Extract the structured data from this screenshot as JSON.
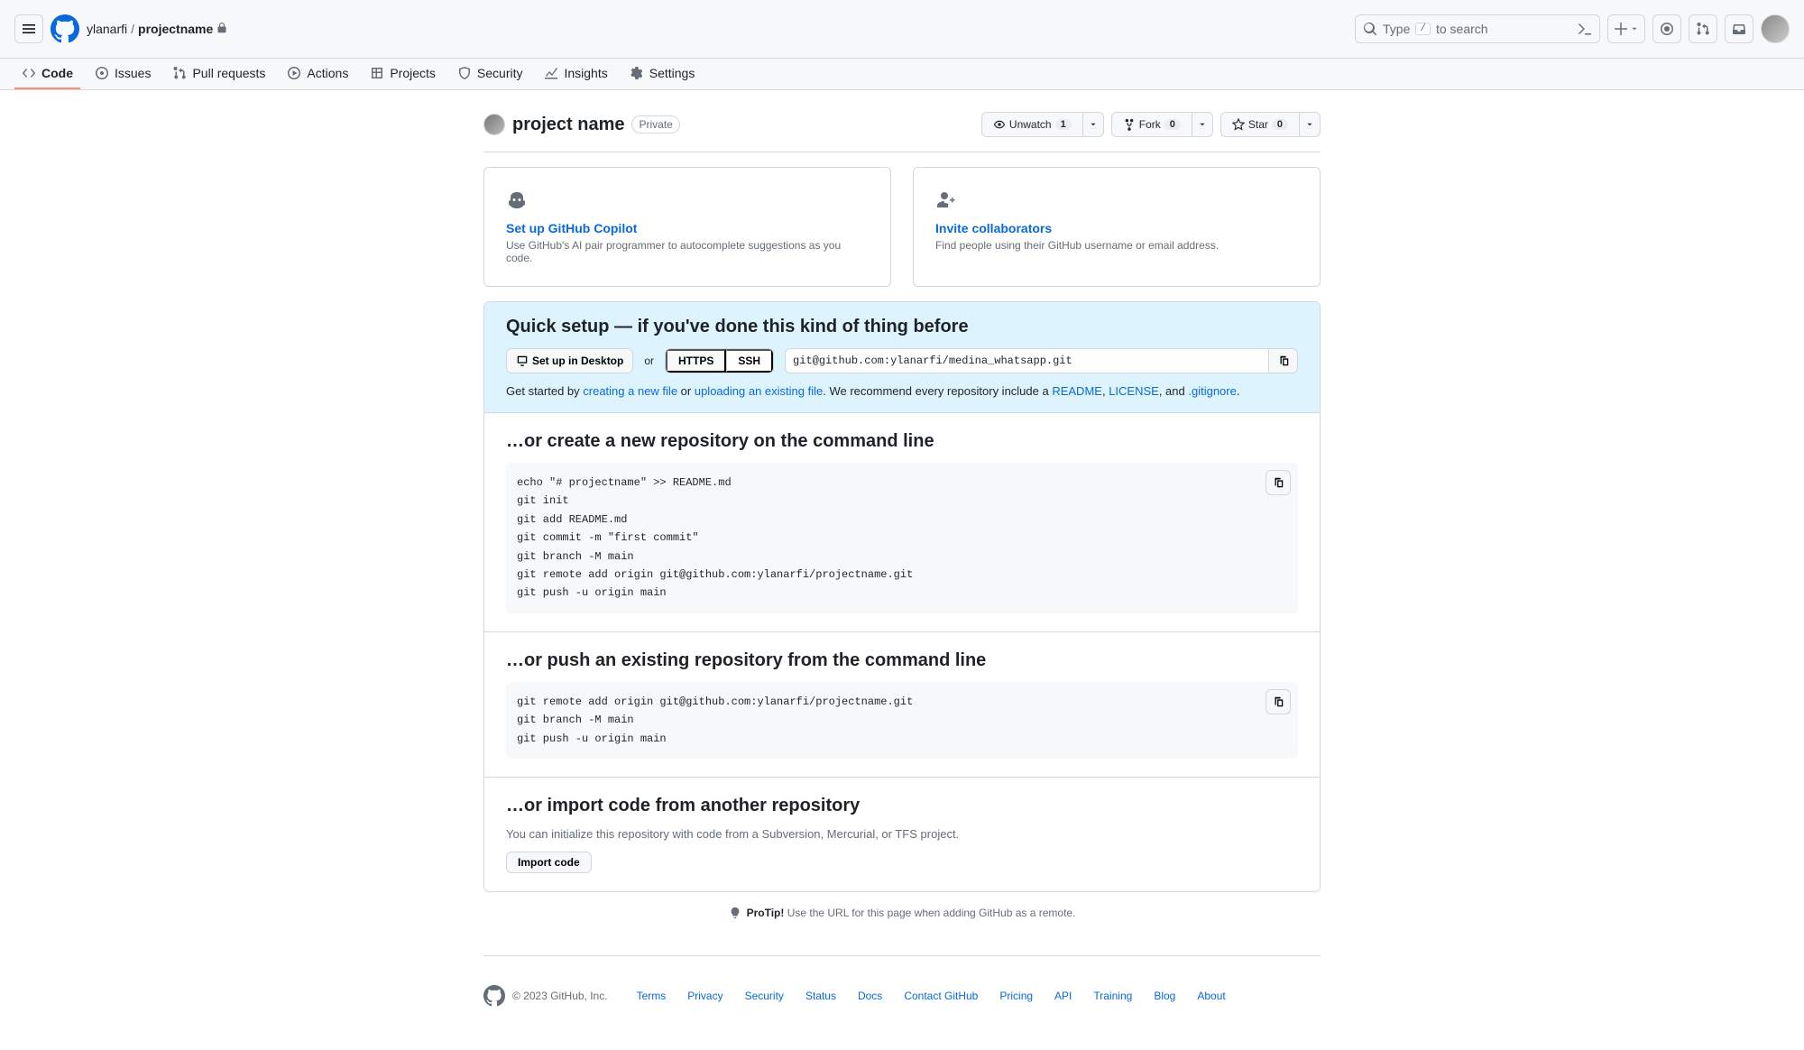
{
  "header": {
    "owner": "ylanarfi",
    "repo": "projectname",
    "search_prefix": "Type",
    "search_key": "/",
    "search_suffix": "to search"
  },
  "nav": {
    "code": "Code",
    "issues": "Issues",
    "pull": "Pull requests",
    "actions": "Actions",
    "projects": "Projects",
    "security": "Security",
    "insights": "Insights",
    "settings": "Settings"
  },
  "title": {
    "name": "project name",
    "visibility": "Private",
    "unwatch": "Unwatch",
    "watch_count": "1",
    "fork": "Fork",
    "fork_count": "0",
    "star": "Star",
    "star_count": "0"
  },
  "cards": {
    "copilot_title": "Set up GitHub Copilot",
    "copilot_desc": "Use GitHub's AI pair programmer to autocomplete suggestions as you code.",
    "invite_title": "Invite collaborators",
    "invite_desc": "Find people using their GitHub username or email address."
  },
  "quick": {
    "heading": "Quick setup — if you've done this kind of thing before",
    "desktop": "Set up in Desktop",
    "or": "or",
    "https": "HTTPS",
    "ssh": "SSH",
    "url": "git@github.com:ylanarfi/medina_whatsapp.git",
    "getstarted_prefix": "Get started by ",
    "create_link": "creating a new file",
    "or2": " or ",
    "upload_link": "uploading an existing file",
    "recommend": ". We recommend every repository include a ",
    "readme": "README",
    "sep1": ", ",
    "license": "LICENSE",
    "sep2": ", and ",
    "gitignore": ".gitignore",
    "period": "."
  },
  "create": {
    "heading": "…or create a new repository on the command line",
    "code": "echo \"# projectname\" >> README.md\ngit init\ngit add README.md\ngit commit -m \"first commit\"\ngit branch -M main\ngit remote add origin git@github.com:ylanarfi/projectname.git\ngit push -u origin main"
  },
  "push": {
    "heading": "…or push an existing repository from the command line",
    "code": "git remote add origin git@github.com:ylanarfi/projectname.git\ngit branch -M main\ngit push -u origin main"
  },
  "import": {
    "heading": "…or import code from another repository",
    "desc": "You can initialize this repository with code from a Subversion, Mercurial, or TFS project.",
    "button": "Import code"
  },
  "protip": {
    "label": "ProTip!",
    "text": " Use the URL for this page when adding GitHub as a remote."
  },
  "footer": {
    "copyright": "© 2023 GitHub, Inc.",
    "links": [
      "Terms",
      "Privacy",
      "Security",
      "Status",
      "Docs",
      "Contact GitHub",
      "Pricing",
      "API",
      "Training",
      "Blog",
      "About"
    ]
  }
}
